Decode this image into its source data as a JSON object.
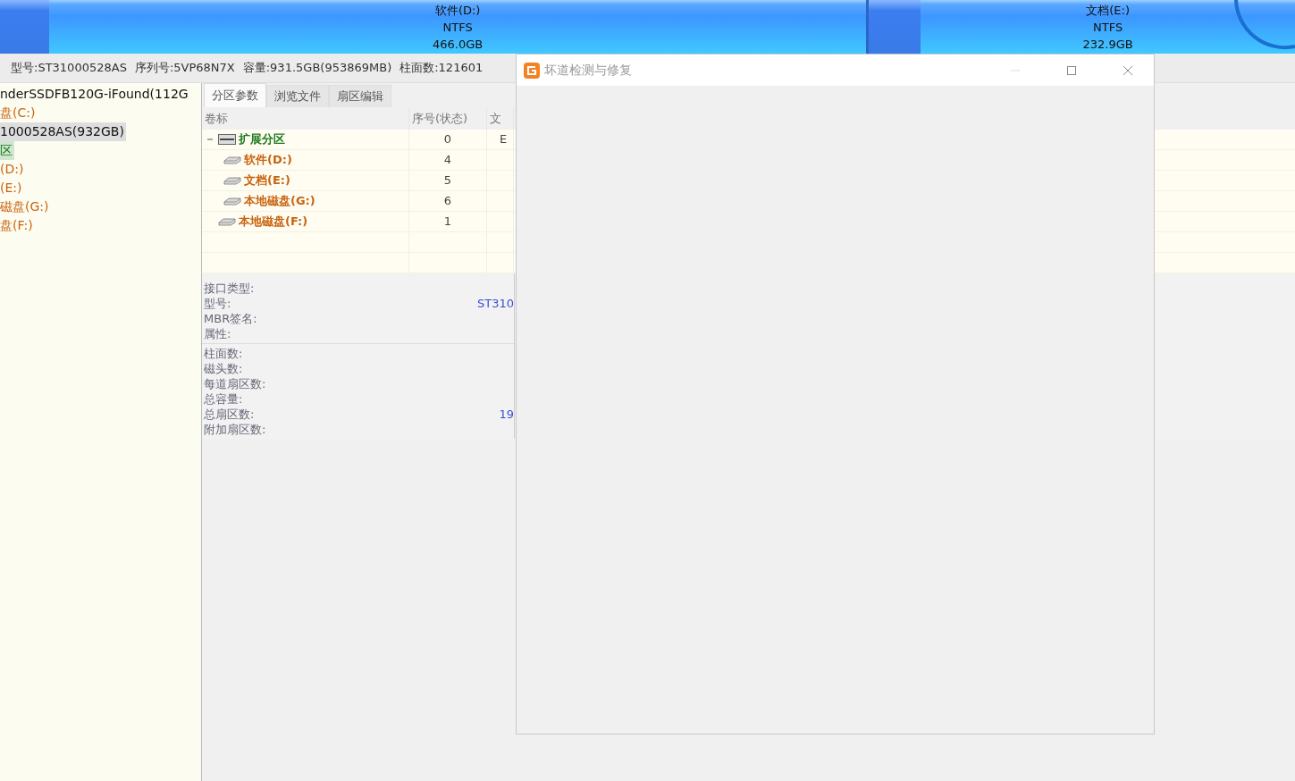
{
  "partition_bar": {
    "segments": [
      {
        "label": "软件(D:)",
        "filesystem": "NTFS",
        "size": "466.0GB"
      },
      {
        "label": "文档(E:)",
        "filesystem": "NTFS",
        "size": "232.9GB"
      }
    ]
  },
  "disk_info": [
    "型号:ST31000528AS",
    "序列号:5VP68N7X",
    "容量:931.5GB(953869MB)",
    "柱面数:121601"
  ],
  "disk_tree": {
    "items": [
      {
        "label": "nderSSDFB120G-iFound(112G",
        "kind": "disk",
        "selected": false
      },
      {
        "label": "盘(C:)",
        "kind": "partition",
        "selected": false
      },
      {
        "label": "1000528AS(932GB)",
        "kind": "disk",
        "selected": true
      },
      {
        "label": "区",
        "kind": "extended",
        "selected": false
      },
      {
        "label": "(D:)",
        "kind": "partition",
        "selected": false
      },
      {
        "label": "(E:)",
        "kind": "partition",
        "selected": false
      },
      {
        "label": "磁盘(G:)",
        "kind": "partition",
        "selected": false
      },
      {
        "label": "盘(F:)",
        "kind": "partition",
        "selected": false
      }
    ]
  },
  "tabs": [
    {
      "label": "分区参数",
      "selected": true
    },
    {
      "label": "浏览文件",
      "selected": false
    },
    {
      "label": "扇区编辑",
      "selected": false
    }
  ],
  "partition_table": {
    "columns": [
      "卷标",
      "序号(状态)",
      "文"
    ],
    "rows": [
      {
        "label": "扩展分区",
        "kind": "extended",
        "number": "0",
        "column_3": "E",
        "expanded": true,
        "children": [
          {
            "label": "软件(D:)",
            "kind": "partition",
            "number": "4"
          },
          {
            "label": "文档(E:)",
            "kind": "partition",
            "number": "5"
          },
          {
            "label": "本地磁盘(G:)",
            "kind": "partition",
            "number": "6"
          }
        ]
      },
      {
        "label": "本地磁盘(F:)",
        "kind": "partition",
        "number": "1"
      }
    ]
  },
  "properties": {
    "groups": [
      [
        {
          "label": "接口类型:"
        },
        {
          "label": "型号:",
          "value": "ST310"
        },
        {
          "label": "MBR签名:"
        },
        {
          "label": "属性:"
        }
      ],
      [
        {
          "label": "柱面数:"
        },
        {
          "label": "磁头数:"
        },
        {
          "label": "每道扇区数:"
        },
        {
          "label": "总容量:"
        },
        {
          "label": "总扇区数:",
          "value": "19"
        },
        {
          "label": "附加扇区数:"
        }
      ]
    ]
  },
  "dialog": {
    "title": "坏道检测与修复"
  }
}
